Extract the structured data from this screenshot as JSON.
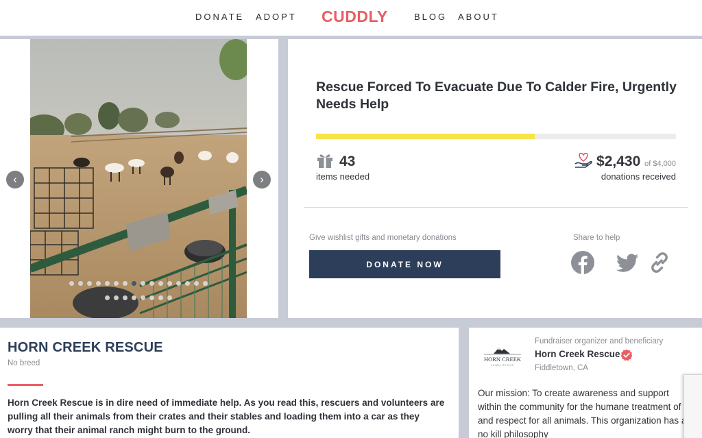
{
  "nav": {
    "links_left": [
      "DONATE",
      "ADOPT"
    ],
    "logo": "CUDDLY",
    "links_right": [
      "BLOG",
      "ABOUT"
    ]
  },
  "carousel": {
    "slide_count_row1": 16,
    "slide_count_row2": 8,
    "active_index": 7,
    "prev_icon": "chevron-left-icon",
    "next_icon": "chevron-right-icon"
  },
  "campaign": {
    "title": "Rescue Forced To Evacuate Due To Calder Fire, Urgently Needs Help",
    "progress_fraction": 0.6075,
    "items_needed_count": "43",
    "items_needed_label": "items needed",
    "donation_amount": "$2,430",
    "donation_goal": "of $4,000",
    "donations_label": "donations received",
    "give_text": "Give wishlist gifts and monetary donations",
    "donate_button": "DONATE NOW",
    "share_text": "Share to help",
    "share_icons": [
      "facebook-icon",
      "twitter-icon",
      "link-icon"
    ]
  },
  "colors": {
    "brand": "#ea5d64",
    "navy": "#2c3e59",
    "progress": "#f7e449"
  },
  "organization": {
    "name": "HORN CREEK RESCUE",
    "breed": "No breed",
    "story": "Horn Creek Rescue is in dire need of immediate help. As you read this, rescuers and volunteers are pulling all their animals from their crates and their stables and loading them into a car as they worry that their animal ranch might burn to the ground.",
    "role": "Fundraiser organizer and beneficiary",
    "display_name": "Horn Creek Rescue",
    "location": "Fiddletown, CA",
    "logo_text": "HORN CREEK",
    "logo_subtext": "ANIMAL RESCUE",
    "mission": "Our mission: To create awareness and support within the community for the humane treatment of and respect for all animals. This organization has a no kill philosophy"
  }
}
